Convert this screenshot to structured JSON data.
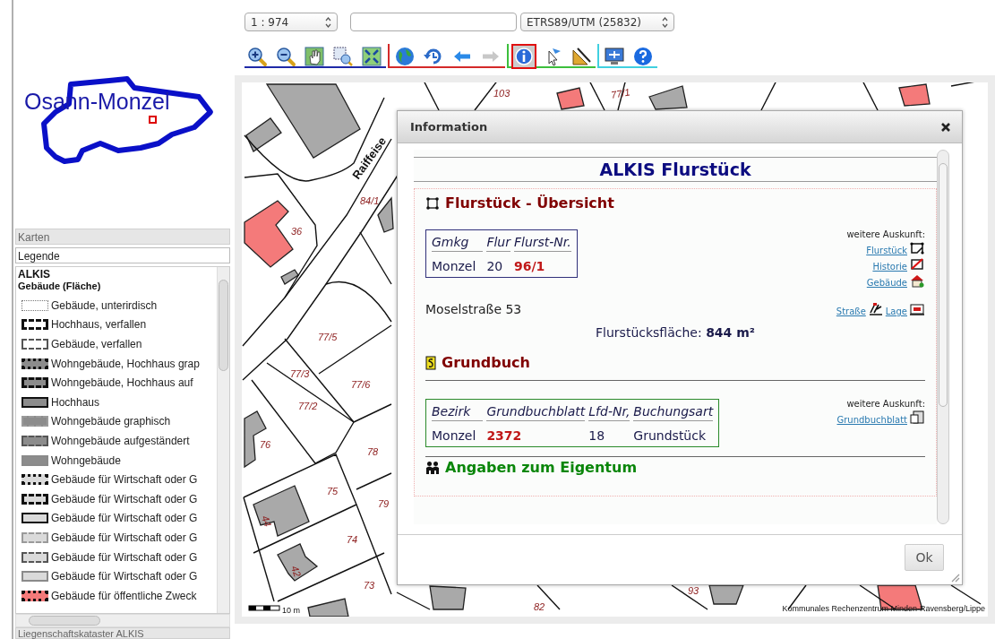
{
  "toolbar": {
    "scale": "1 : 974",
    "projection": "ETRS89/UTM (25832)",
    "groups": [
      {
        "color": "#1f2aa8",
        "tools": [
          {
            "kind": "zoom-in",
            "selected": false,
            "disabled": false
          },
          {
            "kind": "zoom-out",
            "selected": false,
            "disabled": false
          },
          {
            "kind": "pan",
            "selected": false,
            "disabled": false
          },
          {
            "kind": "zoom-box",
            "selected": false,
            "disabled": false
          },
          {
            "kind": "full-extent",
            "selected": false,
            "disabled": false
          }
        ]
      },
      {
        "color": "#d42a2a",
        "tools": [
          {
            "kind": "globe",
            "selected": false,
            "disabled": false
          },
          {
            "kind": "history",
            "selected": false,
            "disabled": false
          },
          {
            "kind": "back",
            "selected": false,
            "disabled": false
          },
          {
            "kind": "forward",
            "selected": false,
            "disabled": true
          }
        ]
      },
      {
        "color": "#3cbf3c",
        "tools": [
          {
            "kind": "info",
            "selected": true,
            "disabled": false
          },
          {
            "kind": "pointer",
            "selected": false,
            "disabled": false
          },
          {
            "kind": "measure",
            "selected": false,
            "disabled": false
          }
        ]
      },
      {
        "color": "#40d0e0",
        "tools": [
          {
            "kind": "monitor",
            "selected": false,
            "disabled": false
          },
          {
            "kind": "help",
            "selected": false,
            "disabled": false
          }
        ]
      }
    ]
  },
  "overview": {
    "place": "Osann-Monzel"
  },
  "accordion": [
    {
      "label": "Karten",
      "selected": false
    },
    {
      "label": "Legende",
      "selected": true
    },
    {
      "label": "Liegenschaftskataster ALKIS",
      "selected": false
    }
  ],
  "legend": {
    "title": "ALKIS",
    "subtitle": "Gebäude (Fläche)",
    "items": [
      {
        "label": "Gebäude, unterirdisch",
        "kind": "dotted",
        "color": "#ffffff"
      },
      {
        "label": "Hochhaus, verfallen",
        "kind": "dashed-bold",
        "color": "#ffffff"
      },
      {
        "label": "Gebäude, verfallen",
        "kind": "dashed",
        "color": "#ffffff"
      },
      {
        "label": "Wohngebäude, Hochhaus grap",
        "kind": "dashdot-bold",
        "color": "#8c8c8c"
      },
      {
        "label": "Wohngebäude, Hochhaus auf",
        "kind": "dashed-bold",
        "color": "#8c8c8c"
      },
      {
        "label": "Hochhaus",
        "kind": "solid-bold",
        "color": "#8c8c8c"
      },
      {
        "label": "Wohngebäude graphisch",
        "kind": "dashdot",
        "color": "#8c8c8c"
      },
      {
        "label": "Wohngebäude aufgeständert",
        "kind": "dashed",
        "color": "#8c8c8c"
      },
      {
        "label": "Wohngebäude",
        "kind": "solid",
        "color": "#8c8c8c"
      },
      {
        "label": "Gebäude für Wirtschaft oder G",
        "kind": "dashdot-bold",
        "color": "#dadada"
      },
      {
        "label": "Gebäude für Wirtschaft oder G",
        "kind": "dashed-bold",
        "color": "#dadada"
      },
      {
        "label": "Gebäude für Wirtschaft oder G",
        "kind": "solid-bold",
        "color": "#dadada"
      },
      {
        "label": "Gebäude für Wirtschaft oder G",
        "kind": "dashdot",
        "color": "#dadada"
      },
      {
        "label": "Gebäude für Wirtschaft oder G",
        "kind": "dashed",
        "color": "#dadada"
      },
      {
        "label": "Gebäude für Wirtschaft oder G",
        "kind": "solid",
        "color": "#dadada"
      },
      {
        "label": "Gebäude für öffentliche Zweck",
        "kind": "dashdot-bold",
        "color": "#f47a7a"
      }
    ]
  },
  "map": {
    "labels": [
      "103",
      "77/1",
      "36",
      "84/1",
      "77/5",
      "77/3",
      "77/6",
      "77/2",
      "76",
      "78",
      "75",
      "79",
      "74",
      "73",
      "44",
      "42",
      "82",
      "93"
    ],
    "street": "Raiffeise",
    "scale_label": "10 m",
    "copyright": "Kommunales Rechenzentrum Minden-Ravensberg/Lippe"
  },
  "dialog": {
    "title": "Information",
    "heading": "ALKIS Flurstück",
    "parcel": {
      "heading": "Flurstück - Übersicht",
      "columns": [
        "Gmkg",
        "Flur",
        "Flurst-Nr."
      ],
      "cells": [
        {
          "text": "Monzel",
          "highlight": false
        },
        {
          "text": "20",
          "highlight": false
        },
        {
          "text": "96/1",
          "highlight": true
        }
      ],
      "more_label": "weitere Auskunft:",
      "links": [
        {
          "label": "Flurstück",
          "kind": "parcel"
        },
        {
          "label": "Historie",
          "kind": "history"
        },
        {
          "label": "Gebäude",
          "kind": "building"
        }
      ],
      "address": "Moselstraße 53",
      "address_links": [
        {
          "label": "Straße",
          "kind": "street"
        },
        {
          "label": "Lage",
          "kind": "location"
        }
      ],
      "area": "Flurstücksfläche: **844 m²**"
    },
    "land_register": {
      "heading": "Grundbuch",
      "columns": [
        "Bezirk",
        "Grundbuchblatt",
        "Lfd-Nr,",
        "Buchungsart"
      ],
      "cells": [
        {
          "text": "Monzel",
          "highlight": false
        },
        {
          "text": "2372",
          "highlight": true
        },
        {
          "text": "18",
          "highlight": false
        },
        {
          "text": "Grundstück",
          "highlight": false
        }
      ],
      "more_label": "weitere Auskunft:",
      "links": [
        {
          "label": "Grundbuchblatt",
          "kind": "sheet"
        }
      ]
    },
    "ownership": {
      "heading": "Angaben zum Eigentum"
    },
    "ok_button": "Ok"
  }
}
